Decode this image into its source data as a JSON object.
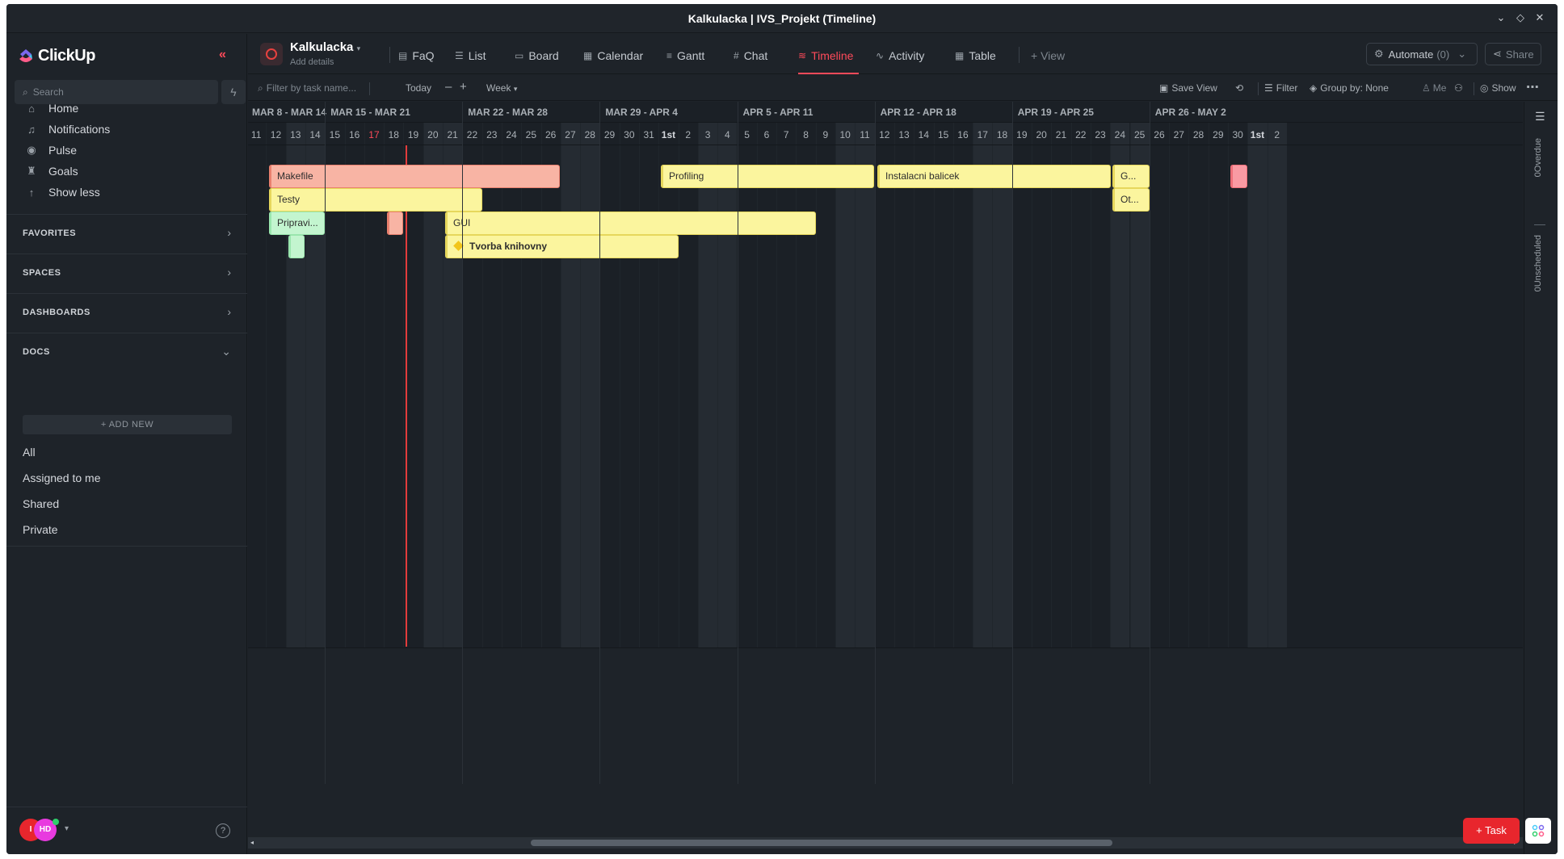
{
  "window": {
    "title": "Kalkulacka | IVS_Projekt (Timeline)"
  },
  "sidebar": {
    "brand": "ClickUp",
    "search_placeholder": "Search",
    "nav": [
      "Home",
      "Notifications",
      "Pulse",
      "Goals",
      "Show less"
    ],
    "sections": [
      "FAVORITES",
      "SPACES",
      "DASHBOARDS",
      "DOCS"
    ],
    "add_new": "+ ADD NEW",
    "docs": [
      "All",
      "Assigned to me",
      "Shared",
      "Private"
    ],
    "avatar1": "I",
    "avatar2": "HD"
  },
  "header": {
    "project": "Kalkulacka",
    "project_sub": "Add details",
    "tabs": [
      "FaQ",
      "List",
      "Board",
      "Calendar",
      "Gantt",
      "Chat",
      "Timeline",
      "Activity",
      "Table",
      "+ View"
    ],
    "active_tab": "Timeline",
    "automate": "Automate",
    "automate_count": "(0)",
    "share": "Share"
  },
  "toolbar": {
    "filter_placeholder": "Filter by task name...",
    "today": "Today",
    "week": "Week",
    "save_view": "Save View",
    "filter": "Filter",
    "group_by": "Group by: None",
    "me": "Me",
    "show": "Show"
  },
  "timeline": {
    "weeks": [
      "MAR 8 - MAR 14",
      "MAR 15 - MAR 21",
      "MAR 22 - MAR 28",
      "MAR 29 - APR 4",
      "APR 5 - APR 11",
      "APR 12 - APR 18",
      "APR 19 - APR 25",
      "APR 26 - MAY 2"
    ],
    "days": [
      "11",
      "12",
      "13",
      "14",
      "15",
      "16",
      "17",
      "18",
      "19",
      "20",
      "21",
      "22",
      "23",
      "24",
      "25",
      "26",
      "27",
      "28",
      "29",
      "30",
      "31",
      "1st",
      "2",
      "3",
      "4",
      "5",
      "6",
      "7",
      "8",
      "9",
      "10",
      "11",
      "12",
      "13",
      "14",
      "15",
      "16",
      "17",
      "18",
      "19",
      "20",
      "21",
      "22",
      "23",
      "24",
      "25",
      "26",
      "27",
      "28",
      "29",
      "30",
      "1st",
      "2"
    ],
    "today_label": "17",
    "tasks": [
      {
        "name": "Makefile",
        "color": "red"
      },
      {
        "name": "Testy",
        "color": "yellow"
      },
      {
        "name": "Pripravi...",
        "color": "green"
      },
      {
        "name": "",
        "color": "red"
      },
      {
        "name": "",
        "color": "green"
      },
      {
        "name": "GUI",
        "color": "yellow"
      },
      {
        "name": "Tvorba knihovny",
        "color": "yellow"
      },
      {
        "name": "Profiling",
        "color": "yellow"
      },
      {
        "name": "Instalacni balicek",
        "color": "yellow"
      },
      {
        "name": "G...",
        "color": "yellow"
      },
      {
        "name": "Ot...",
        "color": "yellow"
      },
      {
        "name": "",
        "color": "pink"
      }
    ]
  },
  "rail": {
    "overdue": "0Overdue",
    "unscheduled": "0Unscheduled"
  },
  "task_button": "+ Task"
}
